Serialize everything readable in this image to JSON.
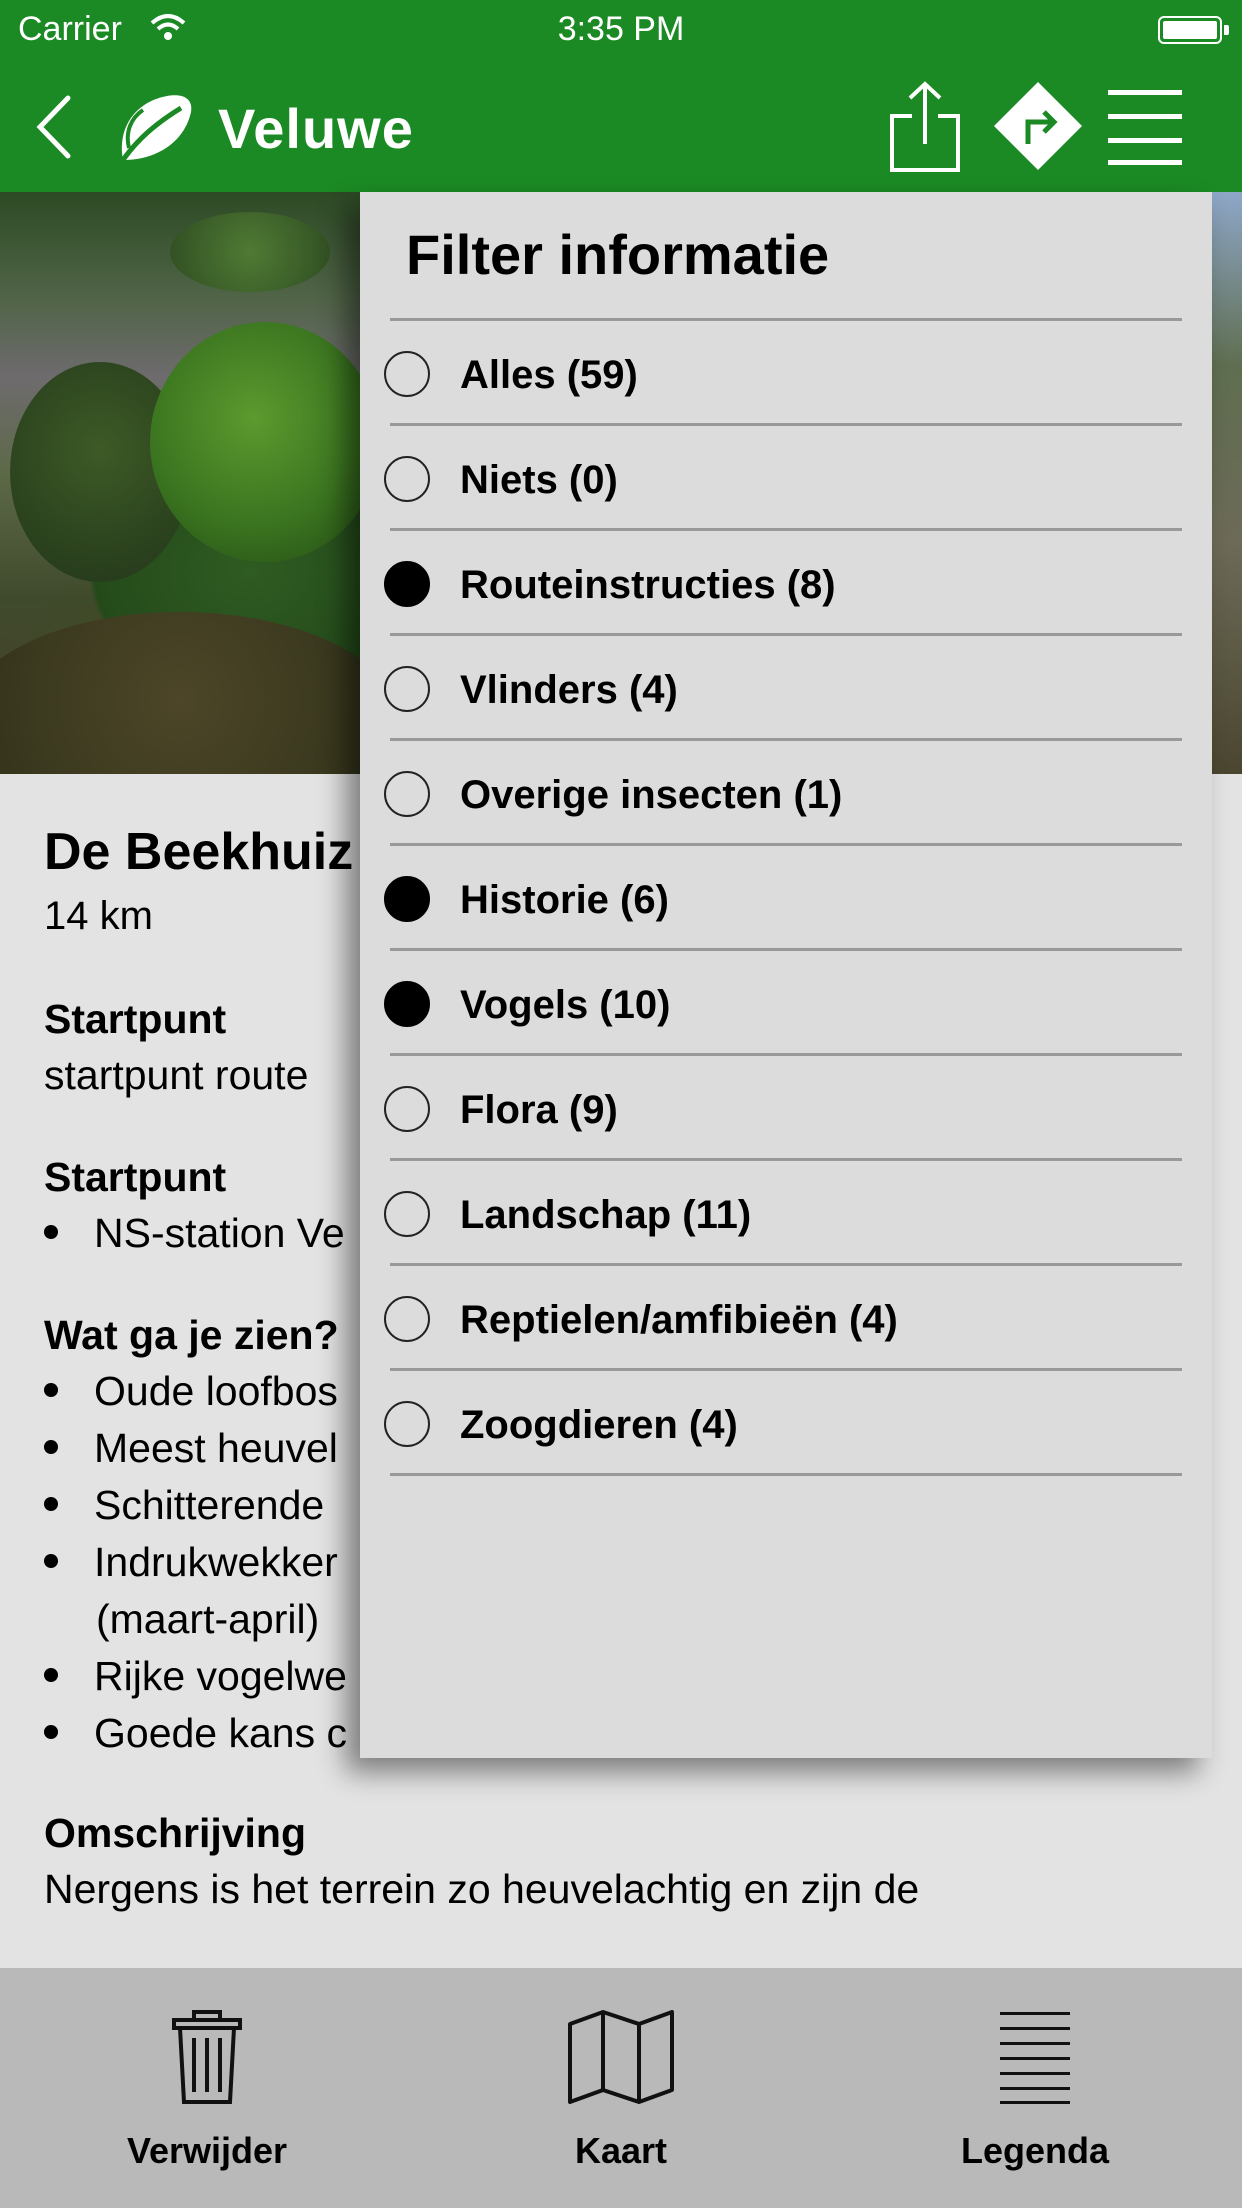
{
  "status_bar": {
    "carrier": "Carrier",
    "time": "3:35 PM"
  },
  "nav": {
    "title": "Veluwe",
    "icons": [
      "back-chevron-icon",
      "leaf-logo-icon",
      "share-icon",
      "route-sign-icon",
      "hamburger-menu-icon"
    ]
  },
  "route": {
    "title": "De Beekhuiz",
    "distance": "14 km",
    "start_heading": "Startpunt",
    "start_text": "startpunt route",
    "start_heading2": "Startpunt",
    "start_bullets": [
      "NS-station Ve"
    ],
    "see_heading": "Wat ga je zien?",
    "see_bullets": [
      "Oude loofbos",
      "Meest heuvel",
      "Schitterende",
      "Indrukwekker",
      "Rijke vogelwe",
      "Goede kans c"
    ],
    "see_continuation": "(maart-april)",
    "desc_heading": "Omschrijving",
    "desc_text": "Nergens is het terrein zo heuvelachtig en zijn de"
  },
  "filter": {
    "title": "Filter informatie",
    "items": [
      {
        "label": "Alles (59)",
        "selected": false
      },
      {
        "label": "Niets (0)",
        "selected": false
      },
      {
        "label": "Routeinstructies (8)",
        "selected": true
      },
      {
        "label": "Vlinders (4)",
        "selected": false
      },
      {
        "label": "Overige insecten (1)",
        "selected": false
      },
      {
        "label": "Historie (6)",
        "selected": true
      },
      {
        "label": "Vogels (10)",
        "selected": true
      },
      {
        "label": "Flora (9)",
        "selected": false
      },
      {
        "label": "Landschap (11)",
        "selected": false
      },
      {
        "label": "Reptielen/amfibieën (4)",
        "selected": false
      },
      {
        "label": "Zoogdieren (4)",
        "selected": false
      }
    ]
  },
  "tabbar": {
    "delete_label": "Verwijder",
    "map_label": "Kaart",
    "legend_label": "Legenda"
  },
  "colors": {
    "brand_green": "#1b8a24",
    "tabbar_gray": "#b9b9b9",
    "popup_gray": "#dcdcdc"
  }
}
